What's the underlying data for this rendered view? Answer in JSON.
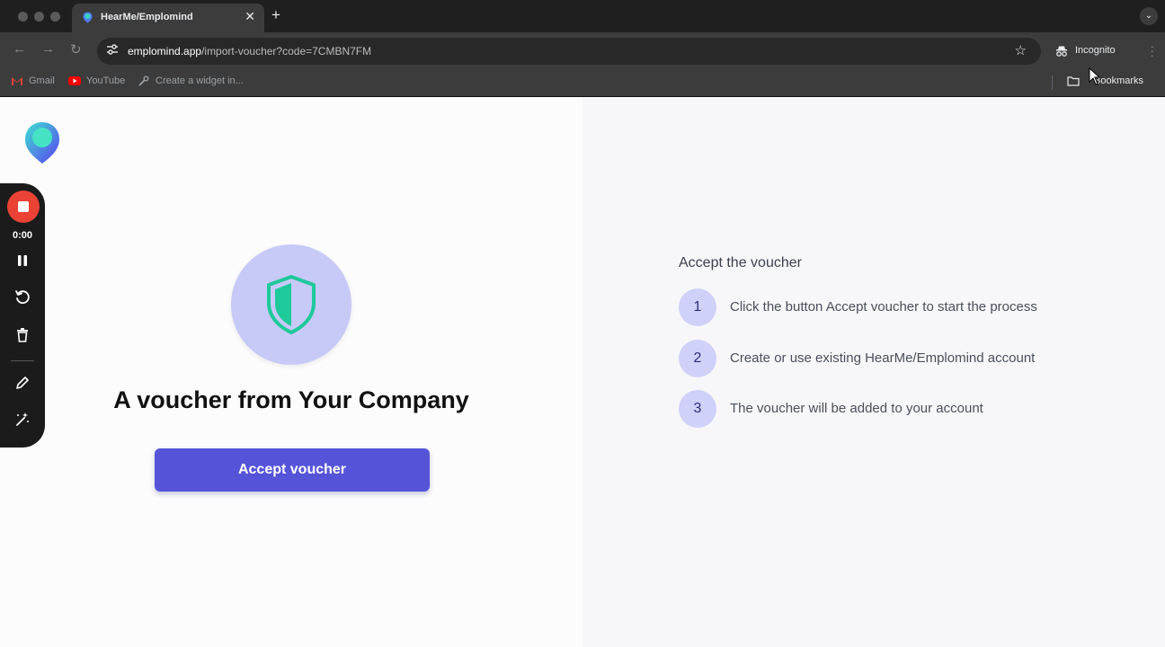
{
  "browser": {
    "tab": {
      "title": "HearMe/Emplomind"
    },
    "address": {
      "host": "emplomind.app",
      "path": "/import-voucher?code=7CMBN7FM"
    },
    "incognito_label": "Incognito",
    "bookmarks": [
      {
        "label": "Gmail",
        "icon": "gmail-icon"
      },
      {
        "label": "YouTube",
        "icon": "youtube-icon"
      },
      {
        "label": "Create a widget in...",
        "icon": "wrench-icon"
      }
    ],
    "all_bookmarks_label": "Bookmarks"
  },
  "recorder": {
    "time": "0:00"
  },
  "main": {
    "title": "A voucher from Your Company",
    "accept_button": "Accept voucher"
  },
  "steps": {
    "heading": "Accept the voucher",
    "items": [
      {
        "number": "1",
        "text": "Click the button Accept voucher to start the process"
      },
      {
        "number": "2",
        "text": "Create or use existing HearMe/Emplomind account"
      },
      {
        "number": "3",
        "text": "The voucher will be added to your account"
      }
    ]
  },
  "colors": {
    "accent": "#5554d9",
    "shield_bg": "#c7c9f7",
    "shield": "#1ec99a",
    "step_bg": "#d0d1f8",
    "record": "#ea4335"
  }
}
